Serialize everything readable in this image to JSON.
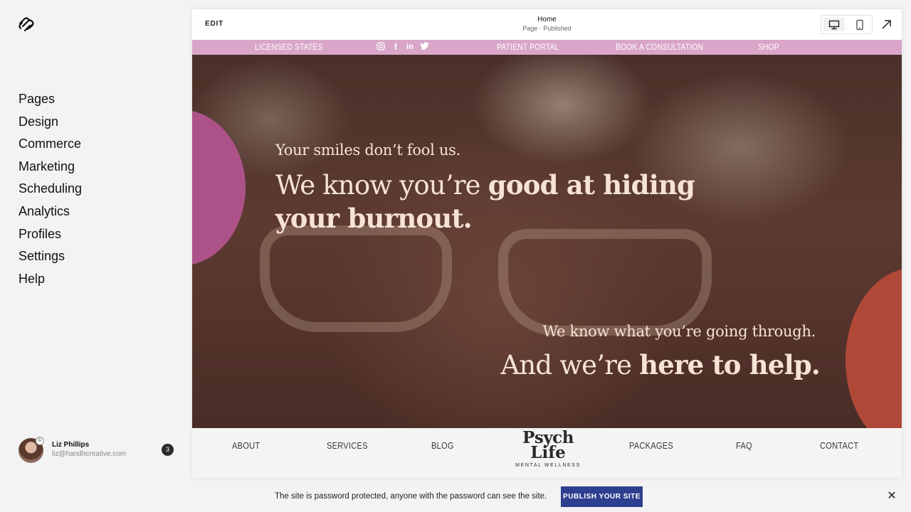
{
  "sidebar": {
    "logo_icon": "squarespace-logo-icon",
    "nav": [
      {
        "label": "Pages"
      },
      {
        "label": "Design"
      },
      {
        "label": "Commerce"
      },
      {
        "label": "Marketing"
      },
      {
        "label": "Scheduling"
      },
      {
        "label": "Analytics"
      },
      {
        "label": "Profiles"
      },
      {
        "label": "Settings"
      },
      {
        "label": "Help"
      }
    ],
    "user": {
      "name": "Liz Phillips",
      "email": "liz@handhcreative.com",
      "notification_count": "3"
    }
  },
  "editor_bar": {
    "edit_label": "EDIT",
    "page_title": "Home",
    "page_status": "Page · Published",
    "icons": [
      "desktop-icon",
      "mobile-icon",
      "open-external-icon"
    ]
  },
  "site": {
    "announcement": {
      "links": [
        "LICENSED STATES",
        "PATIENT PORTAL",
        "BOOK A CONSULTATION",
        "SHOP"
      ],
      "social_icons": [
        "instagram-icon",
        "facebook-icon",
        "linkedin-icon",
        "twitter-icon"
      ],
      "background": "#d9a6c9"
    },
    "hero": {
      "line1": "Your smiles don’t fool us.",
      "headline1_normal": "We know you’re ",
      "headline1_bold": "good at hiding your burnout.",
      "line2": "We know what you’re going through.",
      "headline2_normal": "And we’re ",
      "headline2_bold": "here to help.",
      "accent_pink": "#ad5288",
      "accent_red": "#b04838"
    },
    "nav": {
      "left": [
        "ABOUT",
        "SERVICES",
        "BLOG"
      ],
      "right": [
        "PACKAGES",
        "FAQ",
        "CONTACT"
      ],
      "brand_line1": "Psych",
      "brand_line2": "Life",
      "brand_tagline": "MENTAL WELLNESS"
    }
  },
  "banner": {
    "message": "The site is password protected, anyone with the password can see the site.",
    "button": "PUBLISH YOUR SITE",
    "button_color": "#2d3f8f"
  }
}
